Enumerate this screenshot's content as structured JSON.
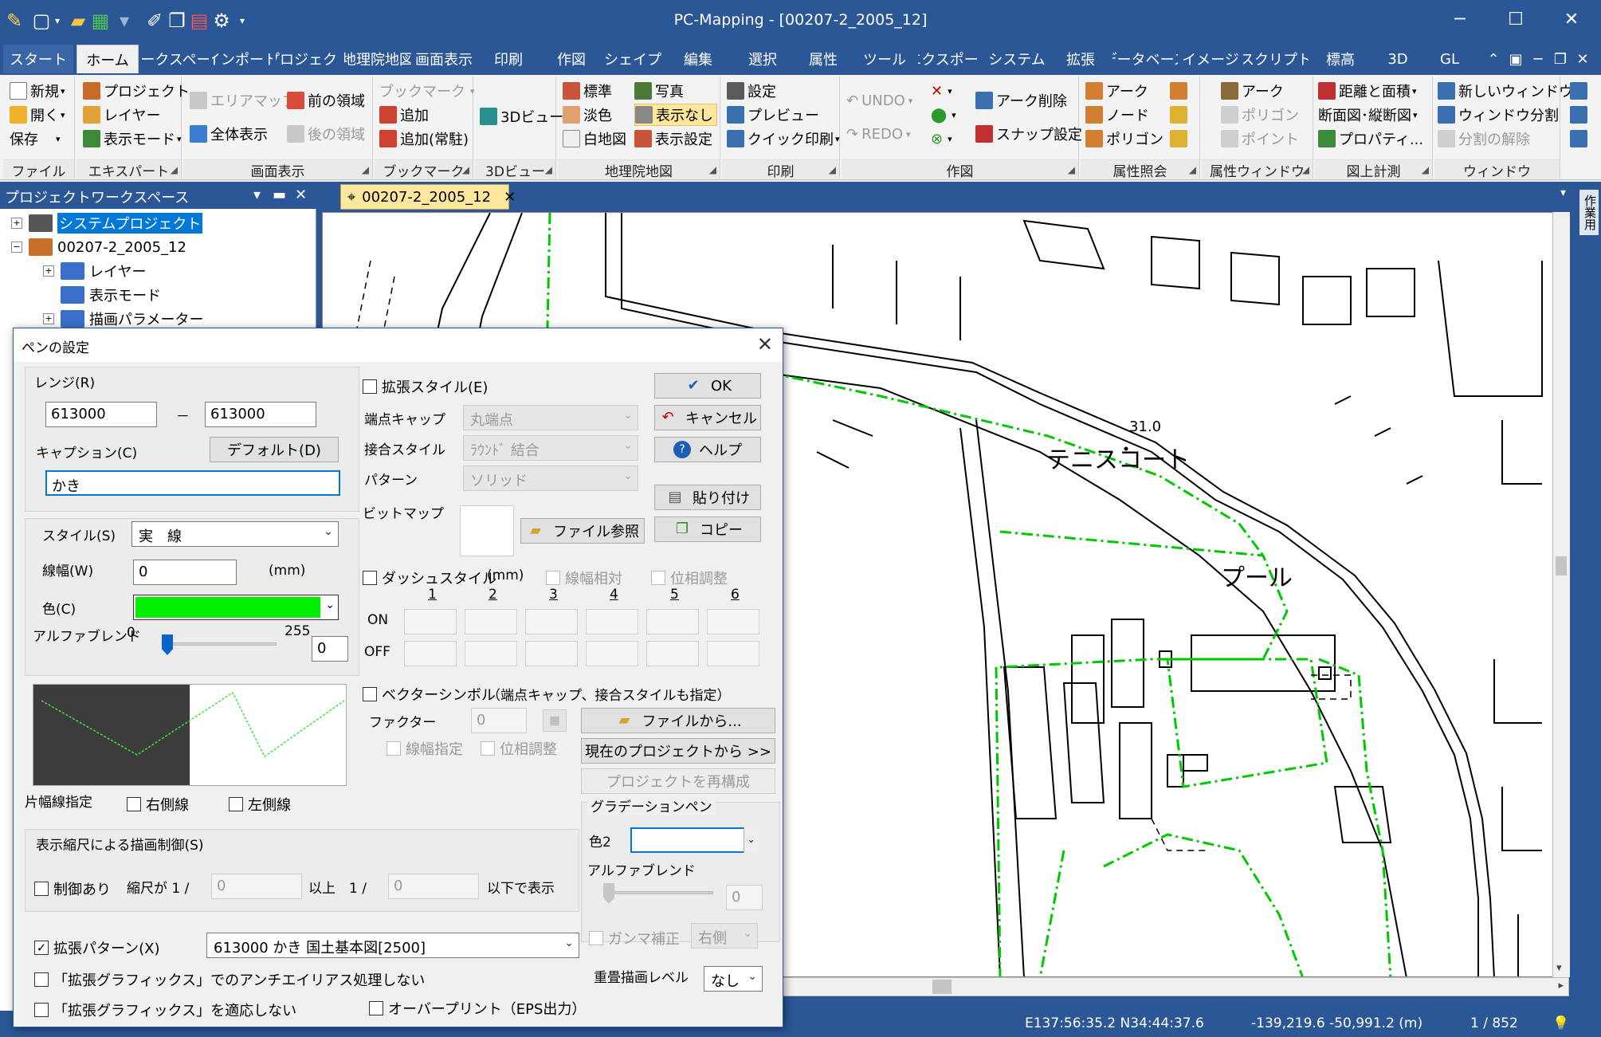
{
  "window": {
    "title": "PC-Mapping - [00207-2_2005_12]"
  },
  "ribbon_tabs": [
    "スタート",
    "ホーム",
    "ワークスペース",
    "インポート",
    "プロジェクト",
    "地理院地図",
    "画面表示",
    "印刷",
    "作図",
    "シェイプ",
    "編集",
    "選択",
    "属性",
    "ツール",
    "エクスポート",
    "システム",
    "拡張",
    "データベース",
    "イメージ",
    "スクリプト",
    "標高",
    "3D",
    "GL"
  ],
  "ribbon": {
    "file": {
      "label": "ファイル",
      "new": "新規",
      "open": "開く",
      "save": "保存"
    },
    "expert": {
      "label": "エキスパート",
      "project": "プロジェクト",
      "layer": "レイヤー",
      "display_mode": "表示モード"
    },
    "screen": {
      "label": "画面表示",
      "area_map": "エリアマップ",
      "prev_area": "前の領域",
      "all_display": "全体表示",
      "next_area": "後の領域"
    },
    "bookmark": {
      "label": "ブックマーク",
      "bookmark": "ブックマーク",
      "add": "追加",
      "add_resident": "追加(常駐)"
    },
    "view3d": {
      "label": "3Dビュー",
      "btn": "3Dビュー"
    },
    "gsi": {
      "label": "地理院地図",
      "standard": "標準",
      "pale": "淡色",
      "blank": "白地図",
      "photo": "写真",
      "no_display": "表示なし",
      "display_settings": "表示設定"
    },
    "print": {
      "label": "印刷",
      "settings": "設定",
      "preview": "プレビュー",
      "quick": "クイック印刷"
    },
    "draw": {
      "label": "作図",
      "undo": "UNDO",
      "redo": "REDO",
      "arc_delete": "アーク削除",
      "snap": "スナップ設定"
    },
    "attr_query": {
      "label": "属性照会",
      "arc": "アーク",
      "node": "ノード",
      "polygon": "ポリゴン"
    },
    "attr_window": {
      "label": "属性ウィンドウ",
      "arc": "アーク",
      "polygon": "ポリゴン",
      "point": "ポイント"
    },
    "measure": {
      "label": "図上計測",
      "distance": "距離と面積",
      "section": "断面図･縦断図",
      "property": "プロパティ..."
    },
    "window": {
      "label": "ウィンドウ",
      "new_window": "新しいウィンドウ",
      "split": "ウィンドウ分割",
      "unsplit": "分割の解除"
    }
  },
  "workspace": {
    "title": "プロジェクトワークスペース",
    "items": [
      "システムプロジェクト",
      "00207-2_2005_12",
      "レイヤー",
      "表示モード",
      "描画パラメーター"
    ]
  },
  "doc_tab": "00207-2_2005_12",
  "side_tab": "作業用",
  "map": {
    "labels": {
      "tennis": "テニスコート",
      "pool": "プール",
      "elevation": "31.0"
    }
  },
  "status": {
    "latlon": "E137:56:35.2 N34:44:37.6",
    "xy": "-139,219.6 -50,991.2 (m)",
    "page": "1 / 852"
  },
  "dialog": {
    "title": "ペンの設定",
    "range_label": "レンジ(R)",
    "range_from": "613000",
    "range_sep": "－",
    "range_to": "613000",
    "caption_label": "キャプション(C)",
    "caption_value": "かき",
    "default_btn": "デフォルト(D)",
    "style_label": "スタイル(S)",
    "style_value": "実　線",
    "width_label": "線幅(W)",
    "width_value": "0",
    "width_unit": "(mm)",
    "color_label": "色(C)",
    "color_value": "#00ee00",
    "alpha_label": "アルファブレンド",
    "alpha_min": "0",
    "alpha_max": "255",
    "alpha_value": "0",
    "half_width_label": "片幅線指定",
    "right_line": "右側線",
    "left_line": "左側線",
    "scale_group": "表示縮尺による描画制御(S)",
    "control": "制御あり",
    "scale_prefix": "縮尺が 1 /",
    "scale_min": "0",
    "scale_mid": "以上　1 /",
    "scale_max": "0",
    "scale_suffix": "以下で表示",
    "ext_pattern": "拡張パターン(X)",
    "ext_pattern_value": "613000 かき 国土基本図[2500]",
    "no_antialias": "「拡張グラフィックス」でのアンチエイリアス処理しない",
    "no_ext_graphics": "「拡張グラフィックス」を適応しない",
    "overprint": "オーバープリント（EPS出力）",
    "ext_style": "拡張スタイル(E)",
    "cap_label": "端点キャップ",
    "cap_value": "丸端点",
    "join_label": "接合スタイル",
    "join_value": "ﾗｳﾝﾄﾞ 結合",
    "pattern_label": "パターン",
    "pattern_value": "ソリッド",
    "bitmap_label": "ビットマップ",
    "file_ref": "ファイル参照",
    "dash_style": "ダッシュスタイル",
    "dash_unit": "(mm)",
    "relative_width": "線幅相対",
    "phase_adjust": "位相調整",
    "dash_cols": [
      "1",
      "2",
      "3",
      "4",
      "5",
      "6"
    ],
    "on": "ON",
    "off": "OFF",
    "vector_symbol": "ベクターシンボル",
    "vector_note": "（端点キャップ、接合スタイルも指定）",
    "factor_label": "ファクター",
    "factor_value": "0",
    "width_spec": "線幅指定",
    "phase_adjust2": "位相調整",
    "from_file": "ファイルから...",
    "from_project": "現在のプロジェクトから >>",
    "rebuild": "プロジェクトを再構成",
    "gradation": "グラデーションペン",
    "color2": "色2",
    "alpha2": "アルファブレンド",
    "alpha2_value": "0",
    "gamma": "ガンマ補正",
    "gamma_side": "右側",
    "overlay_label": "重畳描画レベル",
    "overlay_value": "なし",
    "ok": "OK",
    "cancel": "キャンセル",
    "help": "ヘルプ",
    "paste": "貼り付け",
    "copy": "コピー"
  }
}
